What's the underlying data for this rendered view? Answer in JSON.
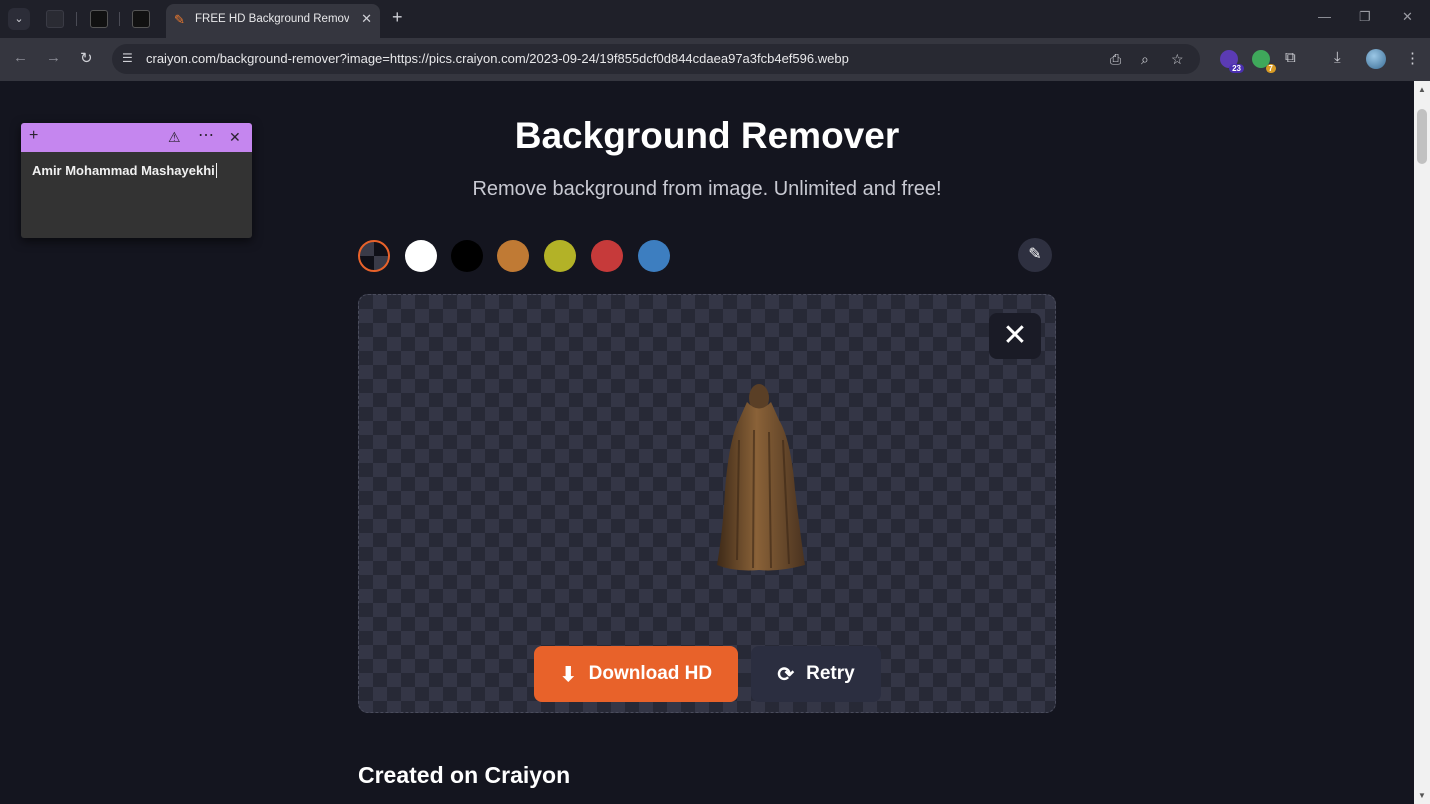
{
  "browser": {
    "tab_title": "FREE HD Background Remover",
    "url": "craiyon.com/background-remover?image=https://pics.craiyon.com/2023-09-24/19f855dcf0d844cdaea97a3fcb4ef596.webp",
    "extension_badges": [
      "23",
      "7"
    ]
  },
  "note": {
    "text": "Amir Mohammad Mashayekhi"
  },
  "page": {
    "title": "Background Remover",
    "subtitle": "Remove background from image. Unlimited and free!",
    "swatches": [
      "transparent",
      "#ffffff",
      "#000000",
      "#c07a34",
      "#b3b227",
      "#c63a3a",
      "#3d7ec0"
    ],
    "download_label": "Download HD",
    "retry_label": "Retry",
    "section_heading": "Created on Craiyon"
  },
  "colors": {
    "accent": "#e8622a",
    "background": "#14151f",
    "note_header": "#c586ef"
  }
}
